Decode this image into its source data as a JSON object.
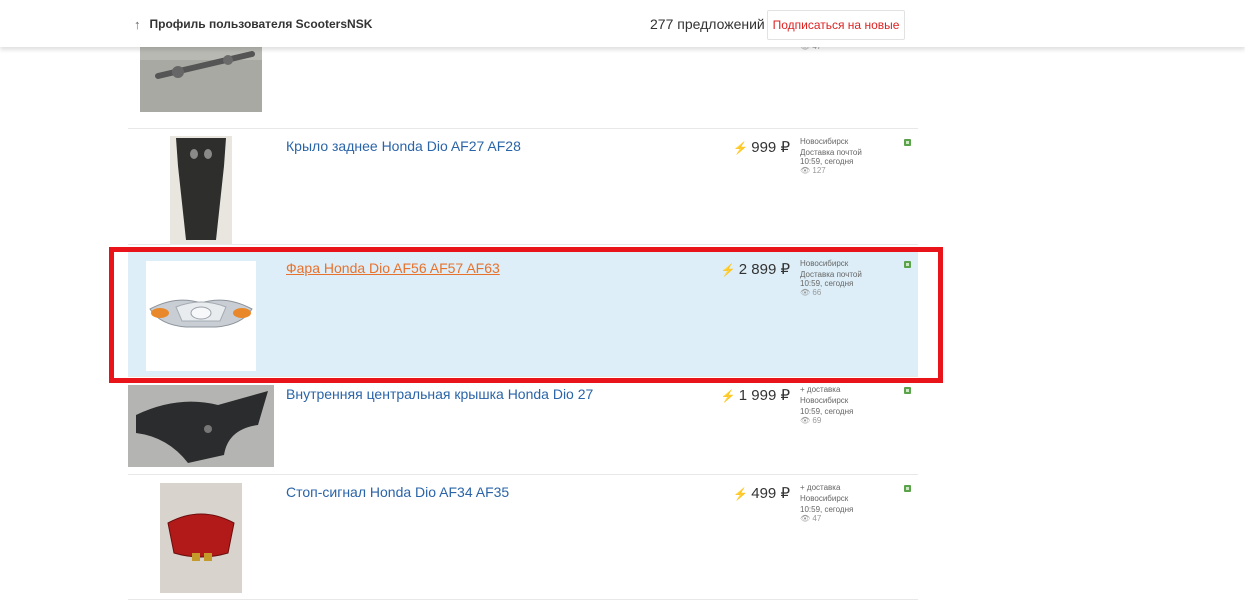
{
  "header": {
    "back_icon": "arrow-up-icon",
    "back_glyph": "↑",
    "profile_link": "Профиль пользователя ScootersNSK",
    "offers_count": "277 предложений",
    "subscribe_label": "Подписаться на новые"
  },
  "listings": [
    {
      "title": "",
      "price": "",
      "city": "",
      "delivery": "",
      "time": "",
      "views": "👁 47"
    },
    {
      "title": "Крыло заднее Honda Dio AF27 AF28",
      "price": "999 ₽",
      "city": "Новосибирск",
      "delivery": "Доставка почтой",
      "time": "10:59, сегодня",
      "views": "👁 127"
    },
    {
      "title": "Фара Honda Dio AF56 AF57 AF63",
      "price": "2 899 ₽",
      "city": "Новосибирск",
      "delivery": "Доставка почтой",
      "time": "10:59, сегодня",
      "views": "👁 66"
    },
    {
      "title": "Внутренняя центральная крышка Honda Dio 27",
      "price": "1 999 ₽",
      "delivery": "+ доставка",
      "city": "Новосибирск",
      "time": "10:59, сегодня",
      "views": "👁 69"
    },
    {
      "title": "Стоп-сигнал Honda Dio AF34 AF35",
      "price": "499 ₽",
      "delivery": "+ доставка",
      "city": "Новосибирск",
      "time": "10:59, сегодня",
      "views": "👁 47"
    }
  ],
  "icons": {
    "price_badge": "lightning-icon",
    "favorite": "favorite-icon",
    "views": "eye-icon"
  },
  "colors": {
    "link": "#2a64a8",
    "visited_link": "#e8712c",
    "highlight_bg": "#ddeef8",
    "annotation_border": "#e8141a",
    "subscribe_text": "#d22"
  }
}
